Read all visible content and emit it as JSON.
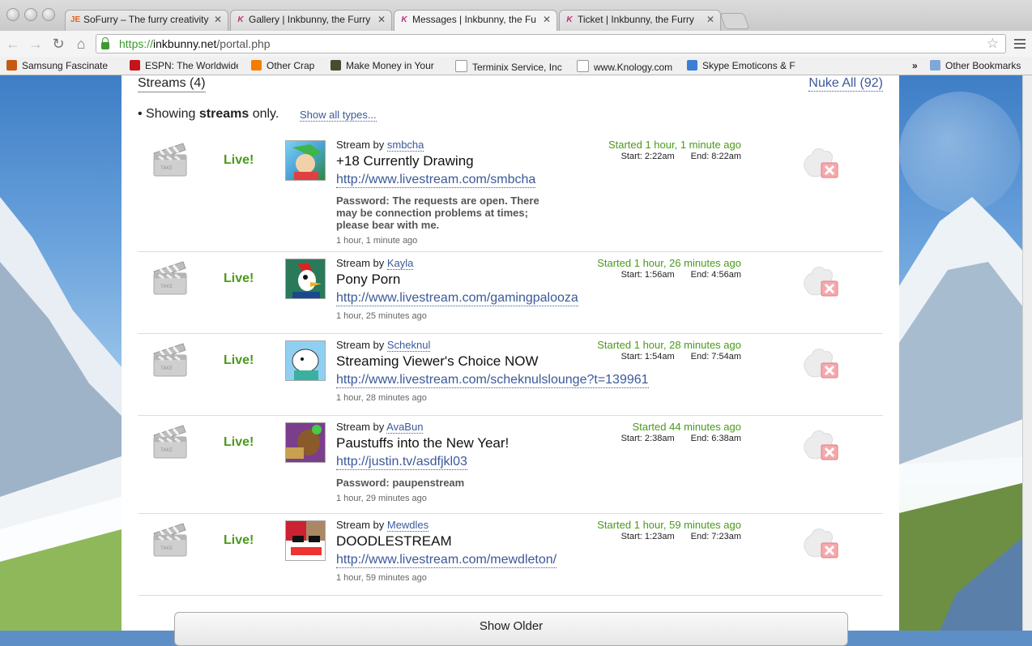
{
  "browser": {
    "tabs": [
      {
        "label": "SoFurry – The furry creativity",
        "favicon": "sofurry-icon"
      },
      {
        "label": "Gallery | Inkbunny, the Furry",
        "favicon": "inkbunny-icon"
      },
      {
        "label": "Messages | Inkbunny, the Fu",
        "favicon": "inkbunny-icon"
      },
      {
        "label": "Ticket | Inkbunny, the Furry",
        "favicon": "inkbunny-icon"
      }
    ],
    "url": {
      "scheme": "https://",
      "host": "inkbunny.net",
      "path": "/portal.php"
    },
    "bookmarks": [
      {
        "label": "Samsung Fascinate",
        "icon": "xda-icon",
        "color": "#c65a13"
      },
      {
        "label": "ESPN: The Worldwide",
        "icon": "espn-icon",
        "color": "#c7141a"
      },
      {
        "label": "Other Crap",
        "icon": "blogger-icon",
        "color": "#f57d00"
      },
      {
        "label": "Make Money in Your",
        "icon": "lh-icon",
        "color": "#4a4a2e"
      },
      {
        "label": "Terminix Service, Inc",
        "icon": "page-icon",
        "color": "#ffffff"
      },
      {
        "label": "www.Knology.com",
        "icon": "page-icon",
        "color": "#ffffff"
      },
      {
        "label": "Skype Emoticons & F",
        "icon": "heart-icon",
        "color": "#3a7fd5"
      }
    ],
    "bookmarks_overflow": "»",
    "other_bookmarks": "Other Bookmarks"
  },
  "section": {
    "title": "Streams (4)",
    "nuke_all": "Nuke All (92)",
    "showing_prefix": "• Showing ",
    "showing_bold": "streams",
    "showing_suffix": " only.",
    "show_all": "Show all types..."
  },
  "streams": [
    {
      "live": "Live!",
      "by_prefix": "Stream by ",
      "user": "smbcha",
      "title": "+18 Currently Drawing",
      "link": "http://www.livestream.com/smbcha",
      "password": "Password: The requests are open. There may be connection problems at times; please bear with me.",
      "ago": "1 hour, 1 minute ago",
      "started": "Started 1 hour, 1 minute ago",
      "start": "Start: 2:22am",
      "end": "End: 8:22am"
    },
    {
      "live": "Live!",
      "by_prefix": "Stream by ",
      "user": "Kayla",
      "title": "Pony Porn",
      "link": "http://www.livestream.com/gamingpalooza",
      "password": "",
      "ago": "1 hour, 25 minutes ago",
      "started": "Started 1 hour, 26 minutes ago",
      "start": "Start: 1:56am",
      "end": "End: 4:56am"
    },
    {
      "live": "Live!",
      "by_prefix": "Stream by ",
      "user": "Scheknul",
      "title": "Streaming Viewer's Choice NOW",
      "link": "http://www.livestream.com/scheknulslounge?t=139961",
      "password": "",
      "ago": "1 hour, 28 minutes ago",
      "started": "Started 1 hour, 28 minutes ago",
      "start": "Start: 1:54am",
      "end": "End: 7:54am"
    },
    {
      "live": "Live!",
      "by_prefix": "Stream by ",
      "user": "AvaBun",
      "title": "Paustuffs into the New Year!",
      "link": "http://justin.tv/asdfjkl03",
      "password": "Password: paupenstream",
      "ago": "1 hour, 29 minutes ago",
      "started": "Started 44 minutes ago",
      "start": "Start: 2:38am",
      "end": "End: 6:38am"
    },
    {
      "live": "Live!",
      "by_prefix": "Stream by ",
      "user": "Mewdles",
      "title": "DOODLESTREAM",
      "link": "http://www.livestream.com/mewdleton/",
      "password": "",
      "ago": "1 hour, 59 minutes ago",
      "started": "Started 1 hour, 59 minutes ago",
      "start": "Start: 1:23am",
      "end": "End: 7:23am"
    }
  ],
  "show_older": "Show Older",
  "colors": {
    "link": "#3b5998",
    "live_green": "#4a9a1a",
    "delete_red": "#e0525a"
  }
}
